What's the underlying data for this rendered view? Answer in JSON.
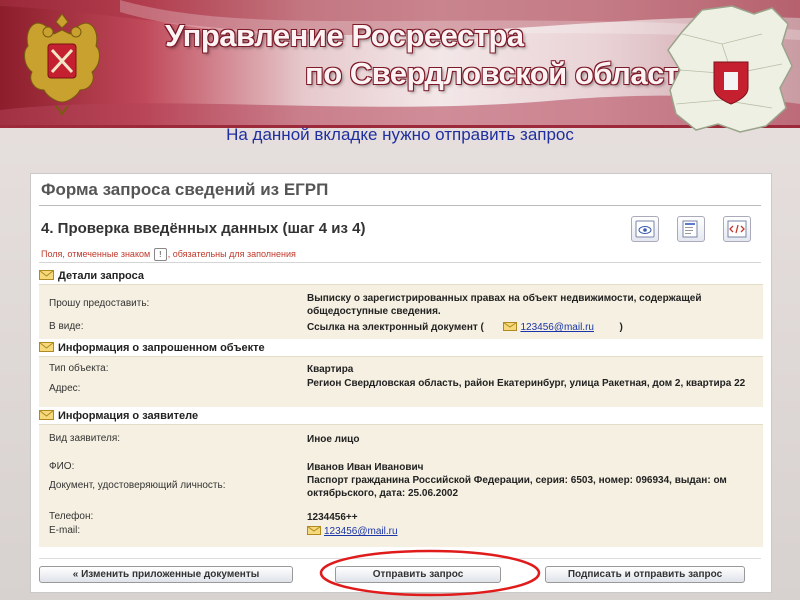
{
  "slide": {
    "title_line1": "Управление Росреестра",
    "title_line2": "по Свердловской области",
    "caption": "На данной вкладке нужно отправить запрос",
    "accent_color": "#9c2a3a",
    "caption_color": "#1f2fa0",
    "highlight_color": "#e01b1b"
  },
  "form": {
    "title": "Форма запроса сведений из ЕГРП",
    "step_title": "4. Проверка введённых данных (шаг 4 из 4)",
    "required_note_before": "Поля, отмеченные знаком",
    "required_mark": "!",
    "required_note_after": ", обязательны для заполнения",
    "toolbar_icons": [
      "preview-icon",
      "print-icon",
      "xml-code-icon"
    ],
    "sections": {
      "request": {
        "heading": "Детали запроса",
        "provide_label": "Прошу предоставить:",
        "provide_value": "Выписку о зарегистрированных правах на объект недвижимости, содержащей общедоступные сведения.",
        "form_label": "В виде:",
        "form_value_prefix": "Ссылка на электронный документ (",
        "form_value_email": "123456@mail.ru",
        "form_value_suffix": ")"
      },
      "object": {
        "heading": "Информация о запрошенном объекте",
        "type_label": "Тип объекта:",
        "type_value": "Квартира",
        "address_label": "Адрес:",
        "address_value": "Регион Свердловская область, район Екатеринбург, улица Ракетная, дом 2, квартира 22"
      },
      "applicant": {
        "heading": "Информация о заявителе",
        "kind_label": "Вид заявителя:",
        "kind_value": "Иное лицо",
        "fio_label": "ФИО:",
        "fio_value": "Иванов Иван Иванович",
        "doc_label": "Документ, удостоверяющий личность:",
        "doc_value": "Паспорт гражданина Российской Федерации, серия: 6503, номер: 096934, выдан: ом октябрьского, дата: 25.06.2002",
        "phone_label": "Телефон:",
        "phone_value": "1234456++",
        "email_label": "E-mail:",
        "email_value": "123456@mail.ru"
      }
    },
    "buttons": {
      "change_docs": "« Изменить приложенные документы",
      "send": "Отправить запрос",
      "sign_send": "Подписать и отправить запрос"
    }
  }
}
